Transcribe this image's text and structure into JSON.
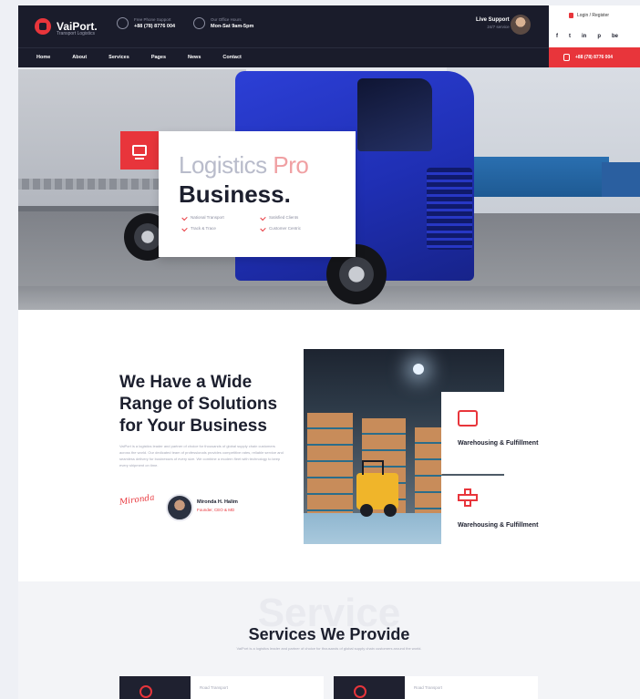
{
  "header": {
    "logo_text": "VaiPort.",
    "logo_tagline": "Transport Logistics",
    "contact_phone_label": "Free Phone Support",
    "contact_phone_value": "+88 (78) 8776 004",
    "contact_hours_label": "Our Office Hours",
    "contact_hours_value": "Mon-Sat 9am-5pm",
    "support_title": "Live Support",
    "support_sub": "24/7 service",
    "login_label": "Login / Register",
    "socials": [
      "f",
      "t",
      "in",
      "p",
      "be"
    ],
    "cta_phone": "+88 (78) 8776 004"
  },
  "nav": [
    "Home",
    "About",
    "Services",
    "Pages",
    "News",
    "Contact"
  ],
  "hero": {
    "title_light": "Logistics",
    "title_accent": "Pro",
    "title_bold": "Business.",
    "features": [
      "National Transport",
      "Satisfied Clients",
      "Track & Trace",
      "Customer Centric"
    ]
  },
  "about": {
    "title": "We Have a Wide Range of Solutions for Your Business",
    "body": "VaiPort is a logistics leader and partner of choice for thousands of global supply chain customers across the world. Our dedicated team of professionals provides competitive rates, reliable service and seamless delivery for businesses of every size. We combine a modern fleet with technology to keep every shipment on time.",
    "signature": "Mironda",
    "ceo_name": "Mironda H. Halim",
    "ceo_role": "Founder, CEO & MD"
  },
  "solutions": [
    {
      "icon": "box-icon",
      "label": "Warehousing & Fulfillment"
    },
    {
      "icon": "cross-icon",
      "label": "Warehousing & Fulfillment"
    }
  ],
  "services": {
    "watermark": "Service",
    "title": "Services We Provide",
    "subtitle": "VaiPort is a logistics leader and partner of choice for thousands of global supply chain customers around the world.",
    "items": [
      {
        "caption": "Road Transport"
      },
      {
        "caption": "Road Transport"
      }
    ]
  },
  "colors": {
    "accent": "#e8353b",
    "dark": "#1a1c2b",
    "brand_blue": "#2c3fd6"
  }
}
